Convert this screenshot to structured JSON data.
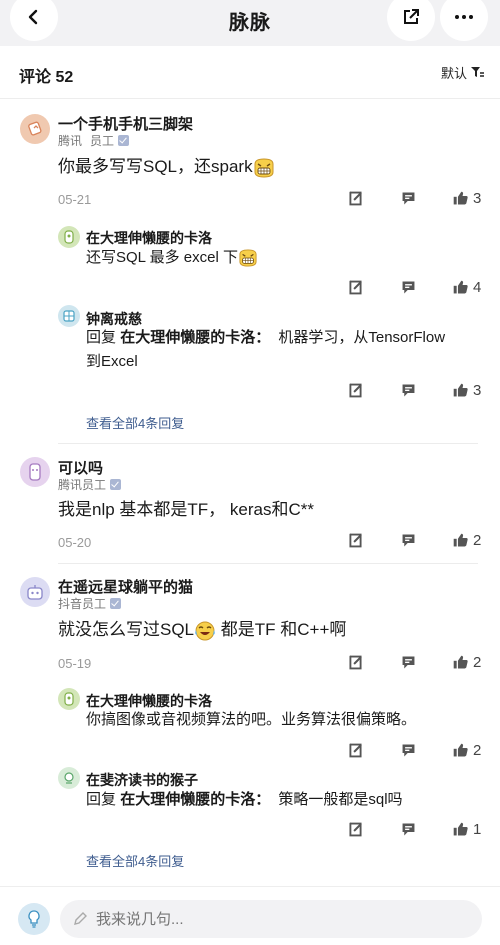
{
  "header": {
    "title": "脉脉"
  },
  "comments_header": {
    "label": "评论 52",
    "sort_label": "默认"
  },
  "threads": [
    {
      "name": "一个手机手机三脚架",
      "company": "腾讯",
      "role": "员工",
      "content_text": "你最多写写SQL，还spark",
      "date": "05-21",
      "likes": "3",
      "replies": [
        {
          "name": "在大理伸懒腰的卡洛",
          "content_text": "还写SQL 最多 excel 下",
          "likes": "4"
        },
        {
          "name": "钟离戒慈",
          "reply_prefix": "回复",
          "reply_to": "在大理伸懒腰的卡洛：",
          "content_line1": "机器学习，从TensorFlow",
          "content_line2": "到Excel",
          "likes": "3"
        }
      ],
      "view_all": "查看全部4条回复"
    },
    {
      "name": "可以吗",
      "company_role": "腾讯员工",
      "content_text": "我是nlp 基本都是TF， keras和C**",
      "date": "05-20",
      "likes": "2"
    },
    {
      "name": "在遥远星球躺平的猫",
      "company_role": "抖音员工",
      "content_before": "就没怎么写过SQL",
      "content_after": " 都是TF 和C++啊",
      "date": "05-19",
      "likes": "2",
      "replies": [
        {
          "name": "在大理伸懒腰的卡洛",
          "content_text": "你搞图像或音视频算法的吧。业务算法很偏策略。",
          "likes": "2"
        },
        {
          "name": "在斐济读书的猴子",
          "reply_prefix": "回复",
          "reply_to": "在大理伸懒腰的卡洛：",
          "content_text": "策略一般都是sql吗",
          "likes": "1"
        }
      ],
      "view_all": "查看全部4条回复"
    }
  ],
  "composer": {
    "placeholder": "我来说几句..."
  }
}
